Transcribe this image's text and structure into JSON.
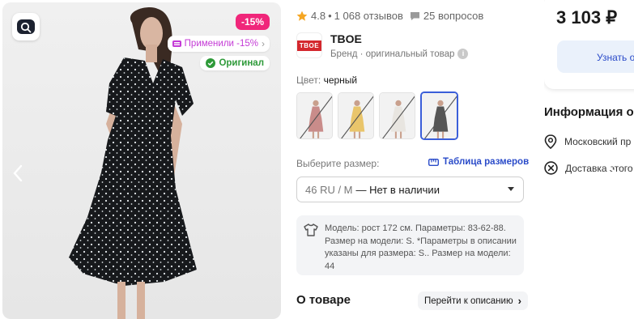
{
  "gallery": {
    "discount_badge": "-15%",
    "applied_badge": "Применили -15%",
    "original_badge": "Оригинал"
  },
  "rating": {
    "value": "4.8",
    "reviews": "1 068 отзывов",
    "questions": "25 вопросов"
  },
  "brand": {
    "logo_text": "TBOE",
    "name": "TBOE",
    "subtitle": "Бренд · оригинальный товар"
  },
  "color": {
    "label": "Цвет:",
    "value": "черный",
    "thumbnails": [
      {
        "shade": "#c98c8a",
        "selected": false
      },
      {
        "shade": "#e9c56b",
        "selected": false
      },
      {
        "shade": "#e8e5e0",
        "selected": false
      },
      {
        "shade": "#555555",
        "selected": true
      }
    ]
  },
  "size": {
    "label": "Выберите размер:",
    "table_link": "Таблица размеров",
    "selected_size": "46 RU / M",
    "availability": "— Нет в наличии"
  },
  "model_info": "Модель: рост 172 см. Параметры: 83-62-88. Размер на модели: S. *Параметры в описании указаны для размера: S.. Размер на модели: 44",
  "about": {
    "title": "О товаре",
    "link": "Перейти к описанию"
  },
  "purchase": {
    "price": "3 103 ₽",
    "notify_button": "Узнать о"
  },
  "delivery_info": {
    "title": "Информация о",
    "rows": [
      {
        "icon": "location-pin-icon",
        "text": "Московский пр"
      },
      {
        "icon": "no-delivery-icon",
        "text": "Доставка этого"
      }
    ]
  },
  "colors": {
    "discount": "#f0267a",
    "applied": "#c43bd6",
    "original": "#2e9a39",
    "accent": "#2a4bc9",
    "star": "#f5a623"
  }
}
